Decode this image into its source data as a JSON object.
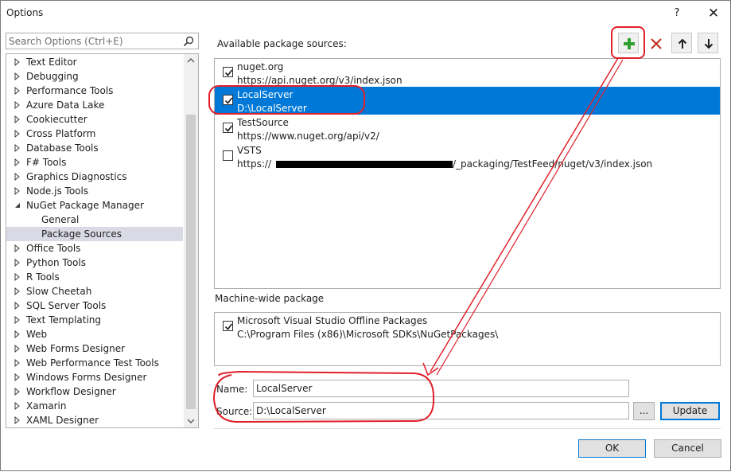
{
  "window": {
    "title": "Options",
    "help_label": "?",
    "close_label": "✕"
  },
  "search": {
    "placeholder": "Search Options (Ctrl+E)"
  },
  "tree": {
    "items": [
      {
        "label": "Text Editor",
        "expanded": false,
        "child": false
      },
      {
        "label": "Debugging",
        "expanded": false,
        "child": false
      },
      {
        "label": "Performance Tools",
        "expanded": false,
        "child": false
      },
      {
        "label": "Azure Data Lake",
        "expanded": false,
        "child": false
      },
      {
        "label": "Cookiecutter",
        "expanded": false,
        "child": false
      },
      {
        "label": "Cross Platform",
        "expanded": false,
        "child": false
      },
      {
        "label": "Database Tools",
        "expanded": false,
        "child": false
      },
      {
        "label": "F# Tools",
        "expanded": false,
        "child": false
      },
      {
        "label": "Graphics Diagnostics",
        "expanded": false,
        "child": false
      },
      {
        "label": "Node.js Tools",
        "expanded": false,
        "child": false
      },
      {
        "label": "NuGet Package Manager",
        "expanded": true,
        "child": false
      },
      {
        "label": "General",
        "child": true
      },
      {
        "label": "Package Sources",
        "child": true,
        "selected": true
      },
      {
        "label": "Office Tools",
        "expanded": false,
        "child": false
      },
      {
        "label": "Python Tools",
        "expanded": false,
        "child": false
      },
      {
        "label": "R Tools",
        "expanded": false,
        "child": false
      },
      {
        "label": "Slow Cheetah",
        "expanded": false,
        "child": false
      },
      {
        "label": "SQL Server Tools",
        "expanded": false,
        "child": false
      },
      {
        "label": "Text Templating",
        "expanded": false,
        "child": false
      },
      {
        "label": "Web",
        "expanded": false,
        "child": false
      },
      {
        "label": "Web Forms Designer",
        "expanded": false,
        "child": false
      },
      {
        "label": "Web Performance Test Tools",
        "expanded": false,
        "child": false
      },
      {
        "label": "Windows Forms Designer",
        "expanded": false,
        "child": false
      },
      {
        "label": "Workflow Designer",
        "expanded": false,
        "child": false
      },
      {
        "label": "Xamarin",
        "expanded": false,
        "child": false
      },
      {
        "label": "XAML Designer",
        "expanded": false,
        "child": false
      }
    ]
  },
  "sources": {
    "label": "Available package sources:",
    "label_access_key": "p",
    "items": [
      {
        "name": "nuget.org",
        "url": "https://api.nuget.org/v3/index.json",
        "checked": true,
        "selected": false
      },
      {
        "name": "LocalServer",
        "url": "D:\\LocalServer",
        "checked": true,
        "selected": true
      },
      {
        "name": "TestSource",
        "url": "https://www.nuget.org/api/v2/",
        "checked": true,
        "selected": false
      },
      {
        "name": "VSTS",
        "url_prefix": "https://",
        "url_suffix": "/_packaging/TestFeed/nuget/v3/index.json",
        "checked": false,
        "selected": false
      }
    ]
  },
  "machine_wide": {
    "label": "Machine-wide package",
    "items": [
      {
        "name": "Microsoft Visual Studio Offline Packages",
        "url": "C:\\Program Files (x86)\\Microsoft SDKs\\NuGetPackages\\",
        "checked": true
      }
    ]
  },
  "form": {
    "name_label": "Name:",
    "name_value": "LocalServer",
    "source_label": "Source:",
    "source_value": "D:\\LocalServer",
    "browse_label": "...",
    "update_label": "Update"
  },
  "footer": {
    "ok_label": "OK",
    "cancel_label": "Cancel"
  },
  "colors": {
    "selection": "#0078d7",
    "annotation": "#e0202a",
    "add_icon": "#2ea02e",
    "remove_icon": "#c42b1c"
  }
}
